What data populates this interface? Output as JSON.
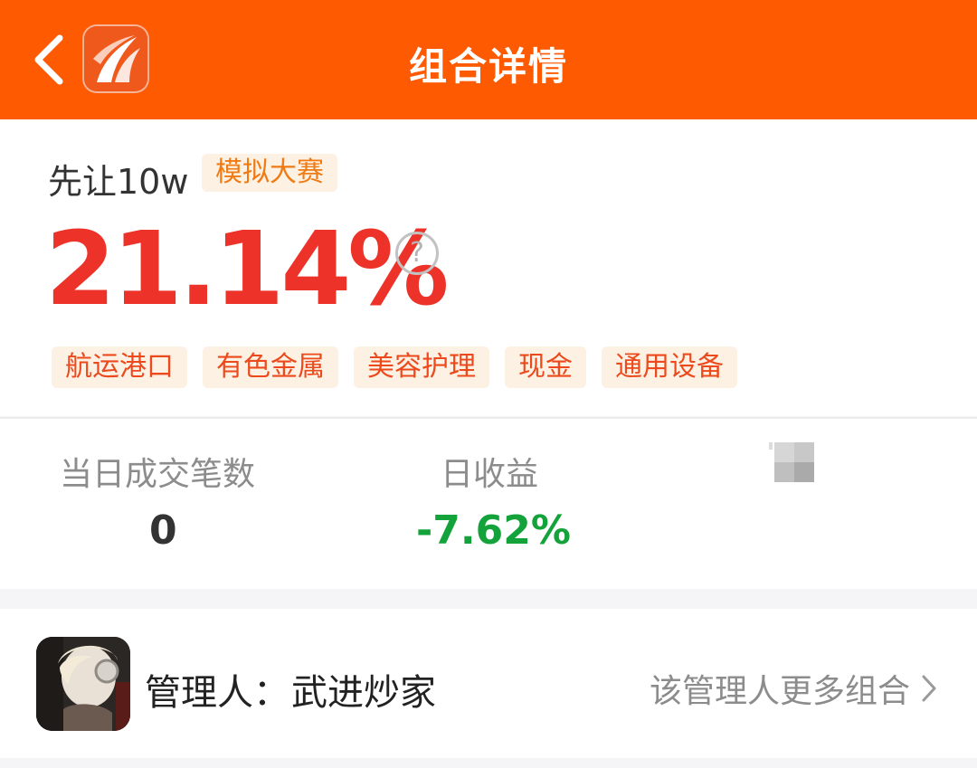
{
  "header": {
    "title": "组合详情",
    "back_icon": "chevron-left-icon",
    "logo_icon": "app-logo-icon",
    "bg_color": "#fd5a02"
  },
  "portfolio": {
    "name": "先让10w",
    "badge": "模拟大赛",
    "total_return": "21.14%",
    "return_color": "#ec3229",
    "help_icon_text": "?",
    "tags": [
      "航运港口",
      "有色金属",
      "美容护理",
      "现金",
      "通用设备"
    ]
  },
  "stats": {
    "trades_label": "当日成交笔数",
    "trades_value": "0",
    "daily_return_label": "日收益",
    "daily_return_value": "-7.62%",
    "daily_return_color": "#14a33b"
  },
  "manager": {
    "label": "管理人：",
    "name": "武进炒家",
    "more_link": "该管理人更多组合"
  }
}
